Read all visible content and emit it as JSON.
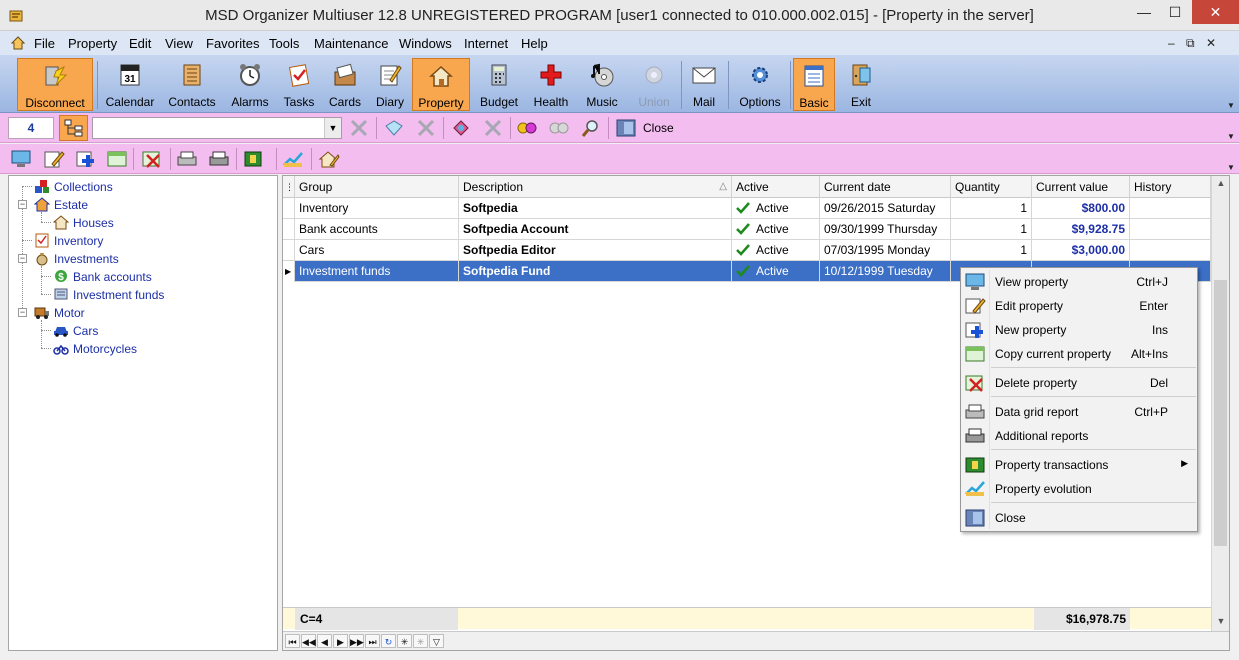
{
  "window": {
    "title": "MSD Organizer Multiuser 12.8 UNREGISTERED PROGRAM [user1 connected to 010.000.002.015] - [Property in the server]",
    "minimize": "—",
    "maximize": "☐",
    "close": "✕"
  },
  "menu": {
    "items": [
      "File",
      "Property",
      "Edit",
      "View",
      "Favorites",
      "Tools",
      "Maintenance",
      "Windows",
      "Internet",
      "Help"
    ],
    "mdi_minimize": "–",
    "mdi_restore": "⧉",
    "mdi_close": "✕"
  },
  "toolbar": {
    "buttons": [
      {
        "label": "Disconnect",
        "icon": "disconnect-icon"
      },
      {
        "label": "Calendar",
        "icon": "calendar-icon"
      },
      {
        "label": "Contacts",
        "icon": "contacts-icon"
      },
      {
        "label": "Alarms",
        "icon": "alarm-clock-icon"
      },
      {
        "label": "Tasks",
        "icon": "tasks-icon"
      },
      {
        "label": "Cards",
        "icon": "cards-icon"
      },
      {
        "label": "Diary",
        "icon": "diary-icon"
      },
      {
        "label": "Property",
        "icon": "house-icon"
      },
      {
        "label": "Budget",
        "icon": "calculator-icon"
      },
      {
        "label": "Health",
        "icon": "red-cross-icon"
      },
      {
        "label": "Music",
        "icon": "music-cd-icon"
      },
      {
        "label": "Union",
        "icon": "union-icon"
      },
      {
        "label": "Mail",
        "icon": "envelope-icon"
      },
      {
        "label": "Options",
        "icon": "gears-icon"
      },
      {
        "label": "Basic",
        "icon": "basic-view-icon"
      },
      {
        "label": "Exit",
        "icon": "exit-door-icon"
      }
    ]
  },
  "filterbar": {
    "count": "4",
    "combo_value": "",
    "close_label": "Close"
  },
  "tree": {
    "nodes": [
      {
        "label": "Collections",
        "icon": "collections-icon"
      },
      {
        "label": "Estate",
        "icon": "estate-icon"
      },
      {
        "label": "Houses",
        "icon": "house-icon"
      },
      {
        "label": "Inventory",
        "icon": "inventory-icon"
      },
      {
        "label": "Investments",
        "icon": "money-bag-icon"
      },
      {
        "label": "Bank accounts",
        "icon": "dollar-icon"
      },
      {
        "label": "Investment funds",
        "icon": "funds-icon"
      },
      {
        "label": "Motor",
        "icon": "truck-icon"
      },
      {
        "label": "Cars",
        "icon": "car-icon"
      },
      {
        "label": "Motorcycles",
        "icon": "motorcycle-icon"
      }
    ]
  },
  "grid": {
    "columns": [
      "Group",
      "Description",
      "Active",
      "Current date",
      "Quantity",
      "Current value",
      "History"
    ],
    "sort_indicator": "△",
    "rows": [
      {
        "group": "Inventory",
        "description": "Softpedia",
        "active": "Active",
        "date": "09/26/2015 Saturday",
        "quantity": "1",
        "value": "$800.00"
      },
      {
        "group": "Bank accounts",
        "description": "Softpedia Account",
        "active": "Active",
        "date": "09/30/1999 Thursday",
        "quantity": "1",
        "value": "$9,928.75"
      },
      {
        "group": "Cars",
        "description": "Softpedia Editor",
        "active": "Active",
        "date": "07/03/1995 Monday",
        "quantity": "1",
        "value": "$3,000.00"
      },
      {
        "group": "Investment funds",
        "description": "Softpedia Fund",
        "active": "Active",
        "date": "10/12/1999 Tuesday",
        "quantity": "",
        "value": ""
      }
    ],
    "row_indicator": "▶",
    "footer_count": "C=4",
    "footer_total": "$16,978.75"
  },
  "context_menu": {
    "items": [
      {
        "label": "View property",
        "shortcut": "Ctrl+J",
        "icon": "monitor-icon"
      },
      {
        "label": "Edit property",
        "shortcut": "Enter",
        "icon": "edit-icon"
      },
      {
        "label": "New property",
        "shortcut": "Ins",
        "icon": "new-plus-icon"
      },
      {
        "label": "Copy current property",
        "shortcut": "Alt+Ins",
        "icon": "copy-icon"
      },
      {
        "label": "Delete property",
        "shortcut": "Del",
        "icon": "delete-icon"
      },
      {
        "label": "Data grid report",
        "shortcut": "Ctrl+P",
        "icon": "printer-icon"
      },
      {
        "label": "Additional reports",
        "shortcut": "",
        "icon": "printer2-icon"
      },
      {
        "label": "Property transactions",
        "shortcut": "",
        "icon": "transactions-icon"
      },
      {
        "label": "Property evolution",
        "shortcut": "",
        "icon": "evolution-icon"
      },
      {
        "label": "Close",
        "shortcut": "",
        "icon": "close-window-icon"
      }
    ],
    "submenu_arrow": "▶"
  },
  "nav": {
    "buttons": [
      "⏮",
      "◀◀",
      "◀",
      "▶",
      "▶▶",
      "⏭",
      "↻",
      "✳",
      "✳",
      "▽"
    ]
  },
  "colors": {
    "toolbar_accent": "#f8a74f",
    "pink_bar": "#f4bdf0",
    "selection": "#3c6fc6",
    "money_text": "#1c2fa6",
    "footer_bg": "#fff9d9"
  }
}
